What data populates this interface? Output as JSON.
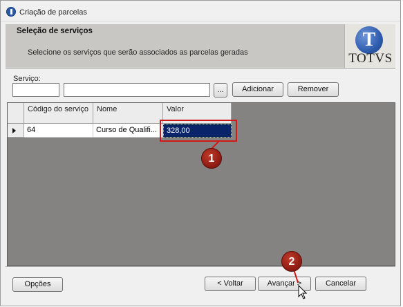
{
  "window": {
    "title": "Criação de parcelas"
  },
  "header": {
    "title": "Seleção de serviços",
    "subtitle": "Selecione os serviços que serão associados as parcelas geradas",
    "logo_text": "TOTVS",
    "logo_letter": "T"
  },
  "service_field": {
    "label": "Serviço:",
    "code_value": "",
    "description_value": "",
    "browse_label": "...",
    "add_label": "Adicionar",
    "remove_label": "Remover"
  },
  "grid": {
    "columns": [
      "Código do serviço",
      "Nome",
      "Valor"
    ],
    "rows": [
      {
        "codigo": "64",
        "nome": "Curso de Qualifi...",
        "valor": "328,00"
      }
    ]
  },
  "annotations": {
    "marker1": "1",
    "marker2": "2",
    "highlight_color": "#d01818"
  },
  "footer": {
    "options_label": "Opções",
    "back_label": "< Voltar",
    "next_label": "Avançar >",
    "cancel_label": "Cancelar"
  }
}
